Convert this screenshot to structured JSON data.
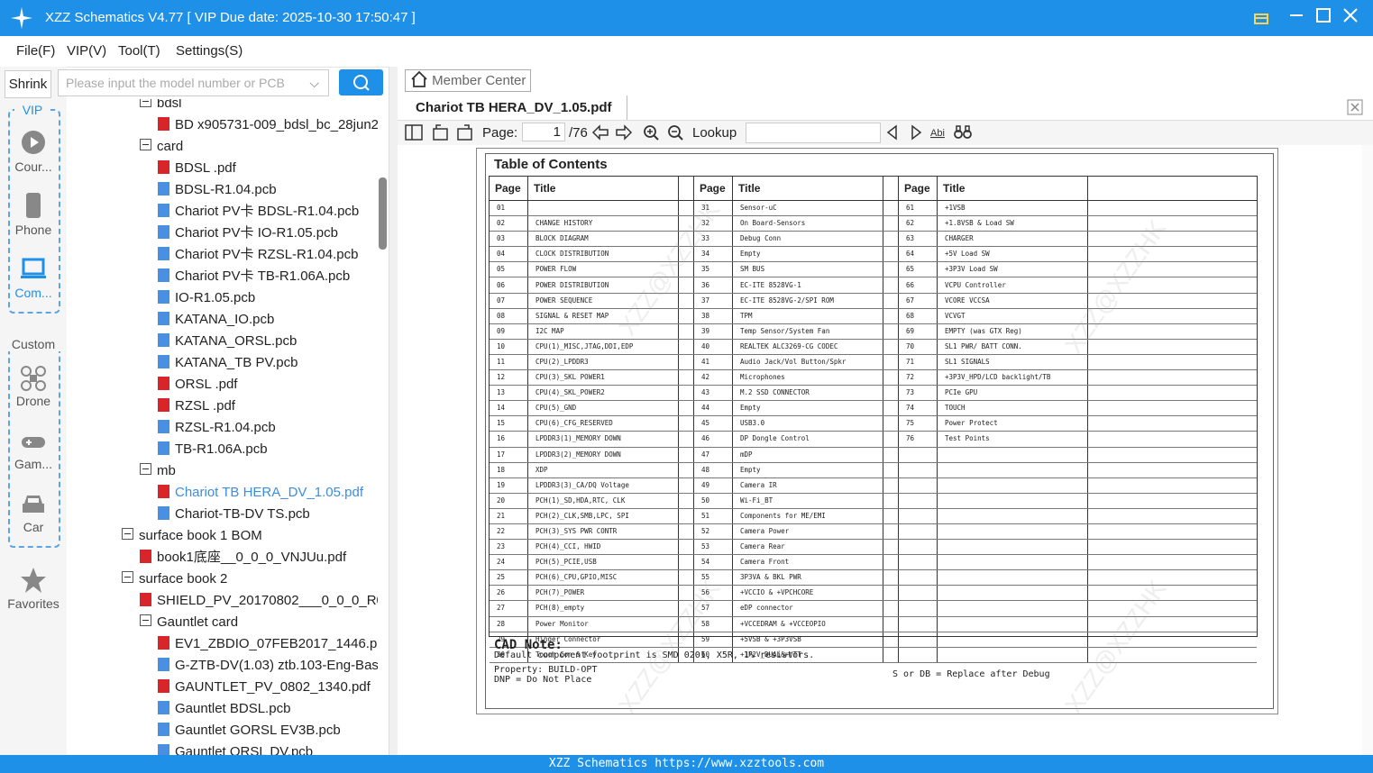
{
  "window": {
    "title": "XZZ Schematics V4.77 [ VIP Due date: 2025-10-30 17:50:47 ]"
  },
  "menu": [
    {
      "label": "File(F)"
    },
    {
      "label": "VIP(V)"
    },
    {
      "label": "Tool(T)"
    },
    {
      "label": "Settings(S)"
    }
  ],
  "search": {
    "shrink_label": "Shrink",
    "placeholder": "Please input the model number or PCB"
  },
  "rail": {
    "vip_title": "VIP",
    "vip_items": [
      {
        "label": "Cour...",
        "icon": "play-icon"
      },
      {
        "label": "Phone",
        "icon": "phone-icon"
      },
      {
        "label": "Com...",
        "icon": "laptop-icon"
      }
    ],
    "custom_title": "Custom",
    "custom_items": [
      {
        "label": "Drone",
        "icon": "drone-icon"
      },
      {
        "label": "Gam...",
        "icon": "gamepad-icon"
      },
      {
        "label": "Car",
        "icon": "car-icon"
      }
    ],
    "favorites_label": "Favorites"
  },
  "tree": [
    {
      "label": "bdsl",
      "type": "folder",
      "level": 2
    },
    {
      "label": "BD    x905731-009_bdsl_bc_28jun2",
      "type": "pdf",
      "level": 3
    },
    {
      "label": "card",
      "type": "folder",
      "level": 2
    },
    {
      "label": "BDSL .pdf",
      "type": "pdf",
      "level": 3
    },
    {
      "label": "BDSL-R1.04.pcb",
      "type": "pcb",
      "level": 3
    },
    {
      "label": "Chariot PV卡 BDSL-R1.04.pcb",
      "type": "pcb",
      "level": 3
    },
    {
      "label": "Chariot PV卡 IO-R1.05.pcb",
      "type": "pcb",
      "level": 3
    },
    {
      "label": "Chariot PV卡 RZSL-R1.04.pcb",
      "type": "pcb",
      "level": 3
    },
    {
      "label": "Chariot PV卡 TB-R1.06A.pcb",
      "type": "pcb",
      "level": 3
    },
    {
      "label": "IO-R1.05.pcb",
      "type": "pcb",
      "level": 3
    },
    {
      "label": "KATANA_IO.pcb",
      "type": "pcb",
      "level": 3
    },
    {
      "label": "KATANA_ORSL.pcb",
      "type": "pcb",
      "level": 3
    },
    {
      "label": "KATANA_TB PV.pcb",
      "type": "pcb",
      "level": 3
    },
    {
      "label": "ORSL  .pdf",
      "type": "pdf",
      "level": 3
    },
    {
      "label": "RZSL .pdf",
      "type": "pdf",
      "level": 3
    },
    {
      "label": "RZSL-R1.04.pcb",
      "type": "pcb",
      "level": 3
    },
    {
      "label": "TB-R1.06A.pcb",
      "type": "pcb",
      "level": 3
    },
    {
      "label": "mb",
      "type": "folder",
      "level": 2
    },
    {
      "label": "Chariot TB HERA_DV_1.05.pdf",
      "type": "pdf",
      "level": 3,
      "selected": true
    },
    {
      "label": "Chariot-TB-DV TS.pcb",
      "type": "pcb",
      "level": 3
    },
    {
      "label": "surface book 1 BOM",
      "type": "folder",
      "level": 1
    },
    {
      "label": "book1底座__0_0_0_VNJUu.pdf",
      "type": "pdf",
      "level": 2
    },
    {
      "label": "surface book 2",
      "type": "folder",
      "level": 1
    },
    {
      "label": "SHIELD_PV_20170802___0_0_0_R0Up5",
      "type": "pdf",
      "level": 2
    },
    {
      "label": "Gauntlet card",
      "type": "folder",
      "level": 2
    },
    {
      "label": "EV1_ZBDIO_07FEB2017_1446.pdf",
      "type": "pdf",
      "level": 3
    },
    {
      "label": "G-ZTB-DV(1.03) ztb.103-Eng-Basic",
      "type": "pcb",
      "level": 3
    },
    {
      "label": "GAUNTLET_PV_0802_1340.pdf",
      "type": "pdf",
      "level": 3
    },
    {
      "label": "Gauntlet BDSL.pcb",
      "type": "pcb",
      "level": 3
    },
    {
      "label": "Gauntlet GORSL EV3B.pcb",
      "type": "pcb",
      "level": 3
    },
    {
      "label": "Gauntlet ORSL DV.pcb",
      "type": "pcb",
      "level": 3
    }
  ],
  "viewer": {
    "member_center": "Member Center",
    "tab_title": "Chariot TB HERA_DV_1.05.pdf",
    "page_label": "Page:",
    "page_value": "1",
    "page_total": "/76",
    "lookup_label": "Lookup"
  },
  "doc": {
    "toc_title": "Table of Contents",
    "col_page": "Page",
    "col_title": "Title",
    "col1": [
      [
        "01",
        ""
      ],
      [
        "02",
        "CHANGE HISTORY"
      ],
      [
        "03",
        "BLOCK DIAGRAM"
      ],
      [
        "04",
        "CLOCK DISTRIBUTION"
      ],
      [
        "05",
        "POWER FLOW"
      ],
      [
        "06",
        "POWER DISTRIBUTION"
      ],
      [
        "07",
        "POWER SEQUENCE"
      ],
      [
        "08",
        "SIGNAL & RESET MAP"
      ],
      [
        "09",
        "I2C MAP"
      ],
      [
        "10",
        "CPU(1)_MISC,JTAG,DDI,EDP"
      ],
      [
        "11",
        "CPU(2)_LPDDR3"
      ],
      [
        "12",
        "CPU(3)_SKL POWER1"
      ],
      [
        "13",
        "CPU(4)_SKL_POWER2"
      ],
      [
        "14",
        "CPU(5)_GND"
      ],
      [
        "15",
        "CPU(6)_CFG_RESERVED"
      ],
      [
        "16",
        "LPDDR3(1)_MEMORY DOWN"
      ],
      [
        "17",
        "LPDDR3(2)_MEMORY DOWN"
      ],
      [
        "18",
        "XDP"
      ],
      [
        "19",
        "LPDDR3(3)_CA/DQ Voltage"
      ],
      [
        "20",
        "PCH(1)_SD,HDA,RTC, CLK"
      ],
      [
        "21",
        "PCH(2)_CLK,SMB,LPC, SPI"
      ],
      [
        "22",
        "PCH(3)_SYS PWR CONTR"
      ],
      [
        "23",
        "PCH(4)_CCI, HWID"
      ],
      [
        "24",
        "PCH(5)_PCIE,USB"
      ],
      [
        "25",
        "PCH(6)_CPU,GPIO,MISC"
      ],
      [
        "26",
        "PCH(7)_POWER"
      ],
      [
        "27",
        "PCH(8)_empty"
      ],
      [
        "28",
        "Power Monitor"
      ],
      [
        "29",
        "Hinger Connector"
      ],
      [
        "30",
        "Touch Con & Key"
      ]
    ],
    "col2": [
      [
        "31",
        "Sensor-uC"
      ],
      [
        "32",
        "On Board-Sensors"
      ],
      [
        "33",
        "Debug Conn"
      ],
      [
        "34",
        "Empty"
      ],
      [
        "35",
        "SM BUS"
      ],
      [
        "36",
        "EC-ITE 8528VG-1"
      ],
      [
        "37",
        "EC-ITE 8528VG-2/SPI ROM"
      ],
      [
        "38",
        "TPM"
      ],
      [
        "39",
        "Temp Sensor/System Fan"
      ],
      [
        "40",
        "REALTEK ALC3269-CG CODEC"
      ],
      [
        "41",
        "Audio Jack/Vol Button/Spkr"
      ],
      [
        "42",
        "Microphones"
      ],
      [
        "43",
        "M.2 SSD CONNECTOR"
      ],
      [
        "44",
        "Empty"
      ],
      [
        "45",
        "USB3.0"
      ],
      [
        "46",
        "DP Dongle Control"
      ],
      [
        "47",
        "mDP"
      ],
      [
        "48",
        "Empty"
      ],
      [
        "49",
        "Camera IR"
      ],
      [
        "50",
        "Wi-Fi_BT"
      ],
      [
        "51",
        "Components for ME/EMI"
      ],
      [
        "52",
        "Camera Power"
      ],
      [
        "53",
        "Camera Rear"
      ],
      [
        "54",
        "Camera Front"
      ],
      [
        "55",
        "3P3VA & BKL PWR"
      ],
      [
        "56",
        "+VCCIO & +VPCHCORE"
      ],
      [
        "57",
        "eDP connector"
      ],
      [
        "58",
        "+VCCEDRAM & +VCCEOPIO"
      ],
      [
        "59",
        "+5VSB & +3P3VSB"
      ],
      [
        "60",
        "+1P2V_DUAL&+VTT"
      ]
    ],
    "col3": [
      [
        "61",
        "+1VSB"
      ],
      [
        "62",
        "+1.8VSB & Load SW"
      ],
      [
        "63",
        "CHARGER"
      ],
      [
        "64",
        "+5V Load SW"
      ],
      [
        "65",
        "+3P3V Load SW"
      ],
      [
        "66",
        "VCPU Controller"
      ],
      [
        "67",
        "VCORE VCCSA"
      ],
      [
        "68",
        "VCVGT"
      ],
      [
        "69",
        "EMPTY (was GTX Reg)"
      ],
      [
        "70",
        "SL1 PWR/ BATT CONN."
      ],
      [
        "71",
        "SL1 SIGNALS"
      ],
      [
        "72",
        "+3P3V_HPD/LCD backlight/TB"
      ],
      [
        "73",
        "PCIe GPU"
      ],
      [
        "74",
        "TOUCH"
      ],
      [
        "75",
        "Power Protect"
      ],
      [
        "76",
        "Test Points"
      ]
    ],
    "note_title": "CAD Note:",
    "note_line1": "Default component footprint is SMD 0201, X5R, 1% resistors.",
    "note_line2": "Property: BUILD-OPT",
    "note_line3": "DNP = Do Not Place",
    "note_line4": "S or DB = Replace after Debug",
    "watermark": "XZZ@XZZHK"
  },
  "footer": {
    "text": "XZZ Schematics https://www.xzztools.com"
  },
  "colors": {
    "accent": "#1e90e8",
    "pdf": "#d9252a",
    "pcb": "#4a90e2",
    "selected": "#3b8de0"
  }
}
